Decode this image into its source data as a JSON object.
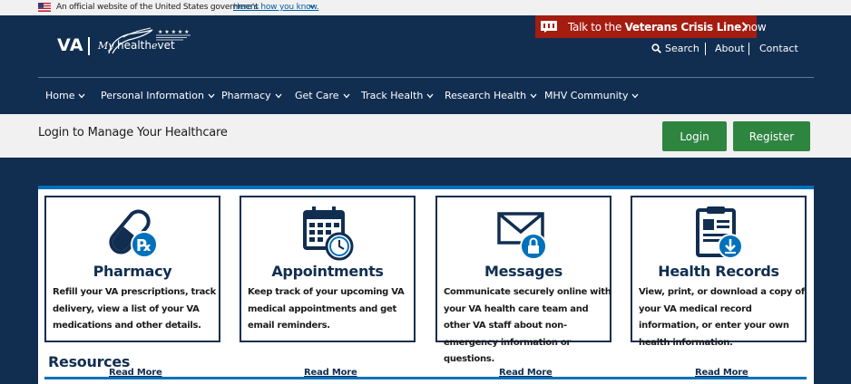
{
  "gov_banner": {
    "text": "An official website of the United States government",
    "link": "Here’s how you know."
  },
  "crisis_line": {
    "prefix": "Talk to the ",
    "bold": "Veterans Crisis Line",
    "suffix": " now"
  },
  "logo": {
    "va": "VA",
    "my": "My",
    "health": "health",
    "e": "e",
    "vet": "vet"
  },
  "utility_nav": {
    "search": "Search",
    "about": "About",
    "contact": "Contact"
  },
  "main_nav": {
    "items": [
      "Home",
      "Personal Information",
      "Pharmacy",
      "Get Care",
      "Track Health",
      "Research Health",
      "MHV Community"
    ]
  },
  "login_bar": {
    "title": "Login to Manage Your Healthcare",
    "login": "Login",
    "register": "Register"
  },
  "cards": [
    {
      "title": "Pharmacy",
      "desc": "Refill your VA prescriptions, track delivery, view a list of your VA medications and other details.",
      "read_more": "Read More"
    },
    {
      "title": "Appointments",
      "desc": "Keep track of your upcoming VA medical appointments and get email reminders.",
      "read_more": "Read More"
    },
    {
      "title": "Messages",
      "desc": "Communicate securely online with your VA health care team and other VA staff about non-emergency information or questions.",
      "read_more": "Read More"
    },
    {
      "title": "Health Records",
      "desc": "View, print, or download a copy of your VA medical record information, or enter your own health information.",
      "read_more": "Read More"
    }
  ],
  "resources": {
    "title": "Resources"
  },
  "colors": {
    "navy": "#112e51",
    "crisis_red": "#a51c11",
    "button_green": "#2e8540",
    "accent_blue": "#0071bb"
  }
}
